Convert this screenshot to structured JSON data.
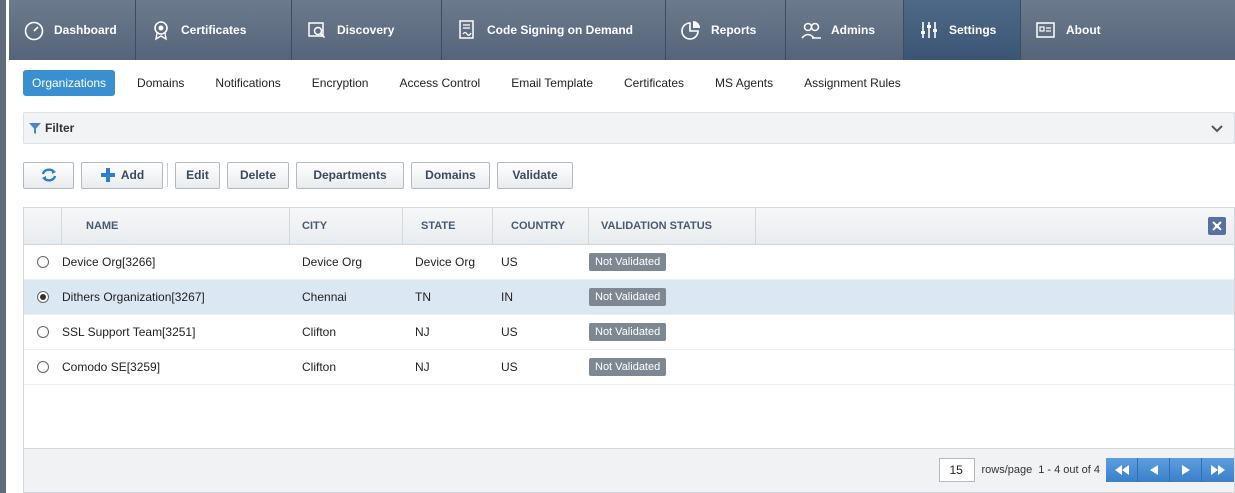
{
  "top_nav": {
    "tabs": [
      {
        "label": "Dashboard",
        "icon": "dashboard-gauge-icon"
      },
      {
        "label": "Certificates",
        "icon": "certificate-badge-icon"
      },
      {
        "label": "Discovery",
        "icon": "discovery-scan-icon"
      },
      {
        "label": "Code Signing on Demand",
        "icon": "code-signing-icon"
      },
      {
        "label": "Reports",
        "icon": "reports-pie-icon"
      },
      {
        "label": "Admins",
        "icon": "admins-users-icon"
      },
      {
        "label": "Settings",
        "icon": "settings-sliders-icon",
        "active": true
      },
      {
        "label": "About",
        "icon": "about-info-icon"
      }
    ]
  },
  "sub_nav": {
    "tabs": [
      {
        "label": "Organizations",
        "active": true
      },
      {
        "label": "Domains"
      },
      {
        "label": "Notifications"
      },
      {
        "label": "Encryption"
      },
      {
        "label": "Access Control"
      },
      {
        "label": "Email Template"
      },
      {
        "label": "Certificates"
      },
      {
        "label": "MS Agents"
      },
      {
        "label": "Assignment Rules"
      }
    ]
  },
  "filter": {
    "label": "Filter",
    "icon": "filter-funnel-icon",
    "toggle_icon": "chevron-down-icon"
  },
  "toolbar": {
    "refresh_icon": "refresh-icon",
    "add_label": "Add",
    "edit_label": "Edit",
    "delete_label": "Delete",
    "departments_label": "Departments",
    "domains_label": "Domains",
    "validate_label": "Validate"
  },
  "grid": {
    "columns": [
      "NAME",
      "CITY",
      "STATE",
      "COUNTRY",
      "VALIDATION STATUS"
    ],
    "column_options_icon": "column-settings-icon",
    "rows": [
      {
        "name": "Device Org[3266]",
        "city": "Device Org",
        "state": "Device Org",
        "country": "US",
        "status": "Not Validated",
        "selected": false
      },
      {
        "name": "Dithers Organization[3267]",
        "city": "Chennai",
        "state": "TN",
        "country": "IN",
        "status": "Not Validated",
        "selected": true
      },
      {
        "name": "SSL Support Team[3251]",
        "city": "Clifton",
        "state": "NJ",
        "country": "US",
        "status": "Not Validated",
        "selected": false
      },
      {
        "name": "Comodo SE[3259]",
        "city": "Clifton",
        "state": "NJ",
        "country": "US",
        "status": "Not Validated",
        "selected": false
      }
    ]
  },
  "pager": {
    "page_size": "15",
    "rows_per_page_label": "rows/page",
    "range_text": "1 - 4 out of 4",
    "colors": {
      "accent": "#3a8fd0",
      "nav": "#5d6b7d",
      "badge": "#7d8892"
    }
  }
}
